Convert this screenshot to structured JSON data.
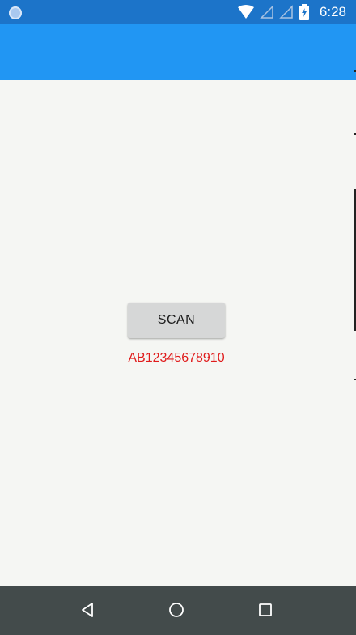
{
  "status_bar": {
    "time": "6:28",
    "icons": [
      "notification-dot-icon",
      "wifi-icon",
      "signal-icon",
      "signal-icon",
      "battery-charging-icon"
    ],
    "colors": {
      "background": "#1c74c9",
      "icon": "#ffffff"
    }
  },
  "app_bar": {
    "color": "#2196f3"
  },
  "main": {
    "scan_button_label": "SCAN",
    "result_text": "AB12345678910",
    "result_color": "#e01b1b",
    "background": "#f5f6f3"
  },
  "nav_bar": {
    "buttons": [
      "back-icon",
      "home-icon",
      "recents-icon"
    ],
    "color": "#434b4b"
  }
}
